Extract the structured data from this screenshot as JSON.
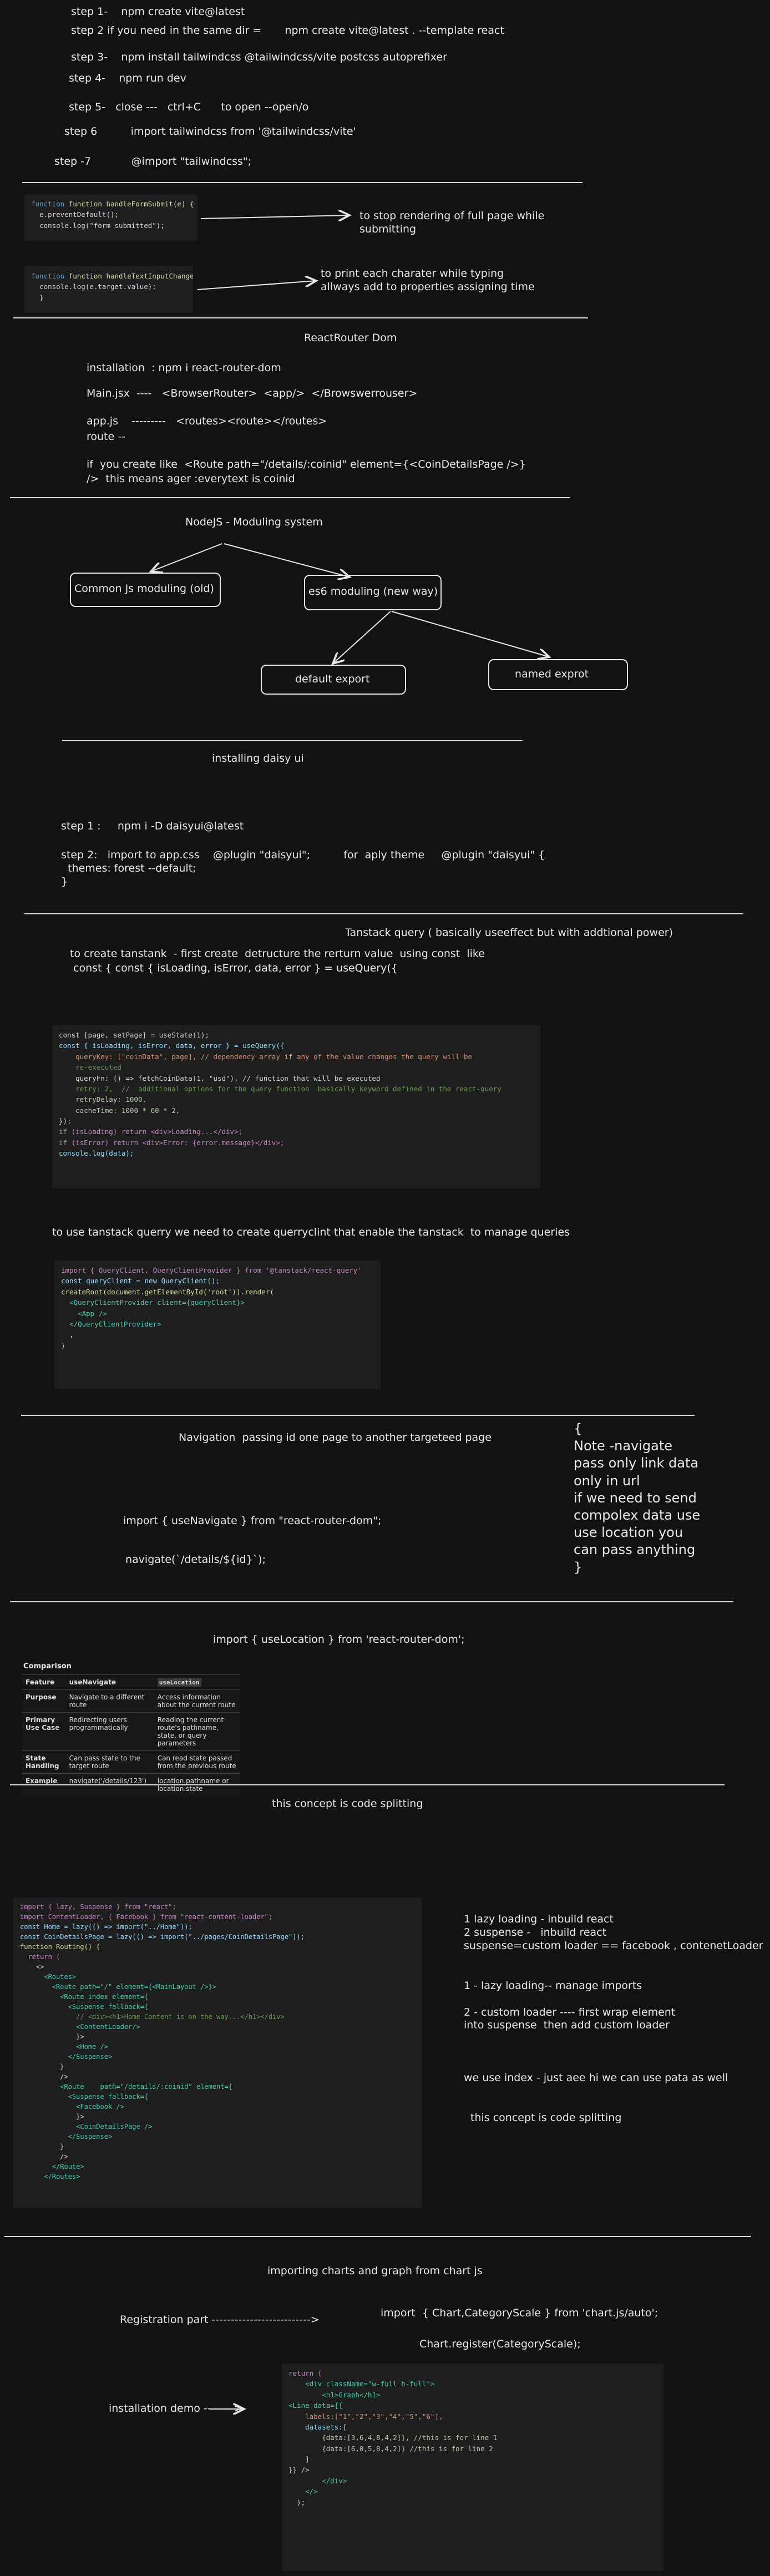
{
  "steps": {
    "s1": "step 1-    npm create vite@latest",
    "s2": "step 2 if you need in the same dir =       npm create vite@latest . --template react",
    "s3": "step 3-    npm install tailwindcss @tailwindcss/vite postcss autoprefixer",
    "s4": "step 4-    npm run dev",
    "s5": "step 5-   close ---   ctrl+C      to open --open/o",
    "s6": "step 6          import tailwindcss from '@tailwindcss/vite'",
    "s7": "step -7            @import \"tailwindcss\";"
  },
  "form_code": [
    "function handleFormSubmit(e) {",
    "  e.preventDefault();",
    "  console.log(\"form submitted\");"
  ],
  "form_note": "to stop rendering of full page while\nsubmitting",
  "input_code": [
    "function handleTextInputChange(e) {",
    "  console.log(e.target.value);",
    "  }"
  ],
  "input_note": "to print each charater while typing\nallways add to properties assigning time",
  "router": {
    "title": "ReactRouter Dom",
    "l1": "installation  : npm i react-router-dom",
    "l2": "Main.jsx  ----   <BrowserRouter>  <app/>  </Browswerrouser>",
    "l3": "app.js    ---------   <routes><route></routes>",
    "l4": "route --",
    "l5": "if  you create like  <Route path=\"/details/:coinid\" element={<CoinDetailsPage />}",
    "l6": "/>  this means ager :everytext is coinid"
  },
  "modules": {
    "title": "NodeJS - Moduling system",
    "common": "Common Js moduling (old)",
    "es6": "es6 moduling (new way)",
    "default_export": "default export",
    "named_export": "named exprot"
  },
  "daisy": {
    "title": "installing daisy ui",
    "step1": "step 1 :     npm i -D daisyui@latest",
    "step2": "step 2:   import to app.css    @plugin \"daisyui\";          for  aply theme     @plugin \"daisyui\" {",
    "step2b": "  themes: forest --default;",
    "step2c": "}"
  },
  "tanstack": {
    "title": "Tanstack query ( basically useeffect but with addtional power)",
    "desc1": "to create tanstank  - first create  detructure the rerturn value  using const  like",
    "desc2": "const { const { isLoading, isError, data, error } = useQuery({",
    "query_code": [
      "const [page, setPage] = useState(1);",
      "",
      "const { isLoading, isError, data, error } = useQuery({",
      "    queryKey: [\"coinData\", page], // dependency array if any of the value changes the query will be",
      "    re-executed",
      "    queryFn: () => fetchCoinData(1, \"usd\"), // function that will be executed",
      "    retry: 2,  //  additional options for the query function  basically keyword defined in the react-query",
      "    retryDelay: 1000,",
      "    cacheTime: 1000 * 60 * 2,",
      "});",
      "",
      "",
      "if (isLoading) return <div>Loading...</div>;",
      "if (isError) return <div>Error: {error.message}</div>;",
      "console.log(data);"
    ],
    "client_note": "to use tanstack querry we need to create querryclint that enable the tanstack  to manage queries",
    "client_code": [
      "import { QueryClient, QueryClientProvider } from '@tanstack/react-query'",
      "const queryClient = new QueryClient();",
      "",
      "createRoot(document.getElementById('root')).render(",
      "  <QueryClientProvider client={queryClient}>",
      "",
      "    <App />",
      "  </QueryClientProvider>",
      "  ,",
      ")"
    ]
  },
  "navigation": {
    "title": "Navigation  passing id one page to another targeteed page",
    "import": "import { useNavigate } from \"react-router-dom\";",
    "call": "navigate(`/details/${id}`);",
    "note": "{\nNote -navigate\npass only link data\nonly in url\nif we need to send\ncompolex data use\nuse location you\ncan pass anything\n}"
  },
  "location": {
    "import": "import { useLocation } from 'react-router-dom';",
    "table_title": "Comparison",
    "headers": [
      "Feature",
      "useNavigate",
      "useLocation"
    ],
    "rows": [
      [
        "Purpose",
        "Navigate to a different route",
        "Access information about the current route"
      ],
      [
        "Primary Use Case",
        "Redirecting users programmatically",
        "Reading the current route's pathname, state, or query parameters"
      ],
      [
        "State Handling",
        "Can pass state to the target route",
        "Can read state passed from the previous route"
      ],
      [
        "Example",
        "navigate('/details/123')",
        "location.pathname or location.state"
      ]
    ]
  },
  "splitting": {
    "title": "this concept is code splitting",
    "code": [
      "import { lazy, Suspense } from \"react\";",
      "import ContentLoader, { Facebook } from \"react-content-loader\";",
      "",
      "const Home = lazy(() => import(\"../Home\"));",
      "const CoinDetailsPage = lazy(() => import(\"../pages/CoinDetailsPage\"));",
      "",
      "function Routing() {",
      "  return (",
      "    <>",
      "      <Routes>",
      "        <Route path=\"/\" element={<MainLayout />}>",
      "          <Route index element={",
      "            <Suspense fallback={",
      "              // <div><h1>Home Content is on the way...</h1></div>",
      "              <ContentLoader/>",
      "              }>",
      "              <Home />",
      "            </Suspense>",
      "          }",
      "          />",
      "          <Route    path=\"/details/:coinid\" element={",
      "            <Suspense fallback={",
      "              <Facebook />",
      "              }>",
      "              <CoinDetailsPage />",
      "            </Suspense>",
      "          }",
      "          />",
      "        </Route>",
      "      </Routes>"
    ],
    "note1": "1 lazy loading - inbuild react\n2 suspense -   inbuild react\nsuspense=custom loader == facebook , contenetLoader",
    "note2": "1 - lazy loading-- manage imports\n\n2 - custom loader ---- first wrap element\ninto suspense  then add custom loader",
    "note3": "we use index - just aee hi we can use pata as well",
    "note4": "this concept is code splitting"
  },
  "charts": {
    "title": "importing charts and graph from chart js",
    "reg_label": "Registration part -------------------------->",
    "reg_import": "import  { Chart,CategoryScale } from 'chart.js/auto';",
    "reg_call": "Chart.register(CategoryScale);",
    "demo_label": "installation demo -------->",
    "code": [
      "return (",
      "",
      "    <div className=\"w-full h-full\">",
      "        <h1>Graph</h1>",
      "<Line data={{",
      "    labels:[\"1\",\"2\",\"3\",\"4\",\"5\",\"6\"],",
      "    datasets:[",
      "        {data:[3,6,4,8,4,2]}, //this is for line 1",
      "        {data:[6,0,5,8,4,2]} //this is for line 2",
      "    ]",
      "}} />",
      "",
      "",
      "",
      "        </div>",
      "    </>",
      "  );"
    ]
  }
}
